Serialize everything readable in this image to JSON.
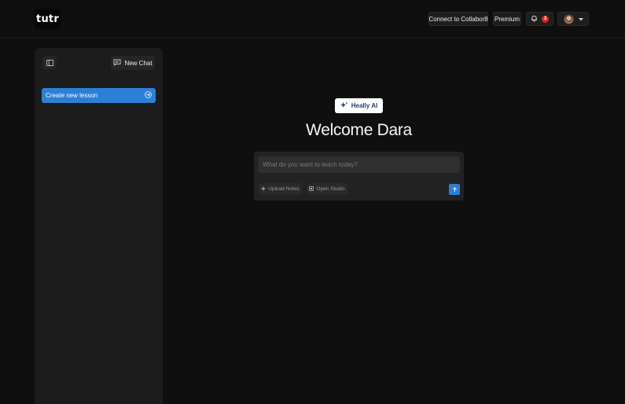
{
  "header": {
    "logo": "tutr",
    "connect_label": "Connect to Collabor8",
    "premium_label": "Premium",
    "notification_count": "3"
  },
  "sidebar": {
    "new_chat_label": "New Chat",
    "create_lesson_label": "Create new lesson"
  },
  "main": {
    "ai_badge_label": "Heally AI",
    "welcome_text": "Welcome Dara",
    "prompt_placeholder": "What do you want to teach today?",
    "upload_label": "Upload Notes",
    "studio_label": "Open Studio"
  },
  "colors": {
    "background": "#0f0f0f",
    "sidebar": "#1c1c1c",
    "accent": "#2d7fd6",
    "badge": "#e02424"
  },
  "icons": [
    "sidebar-toggle-icon",
    "chat-icon",
    "arrow-right-circle-icon",
    "sparkle-icon",
    "plus-icon",
    "studio-icon",
    "arrow-up-icon",
    "bell-icon",
    "chevron-down-icon"
  ]
}
